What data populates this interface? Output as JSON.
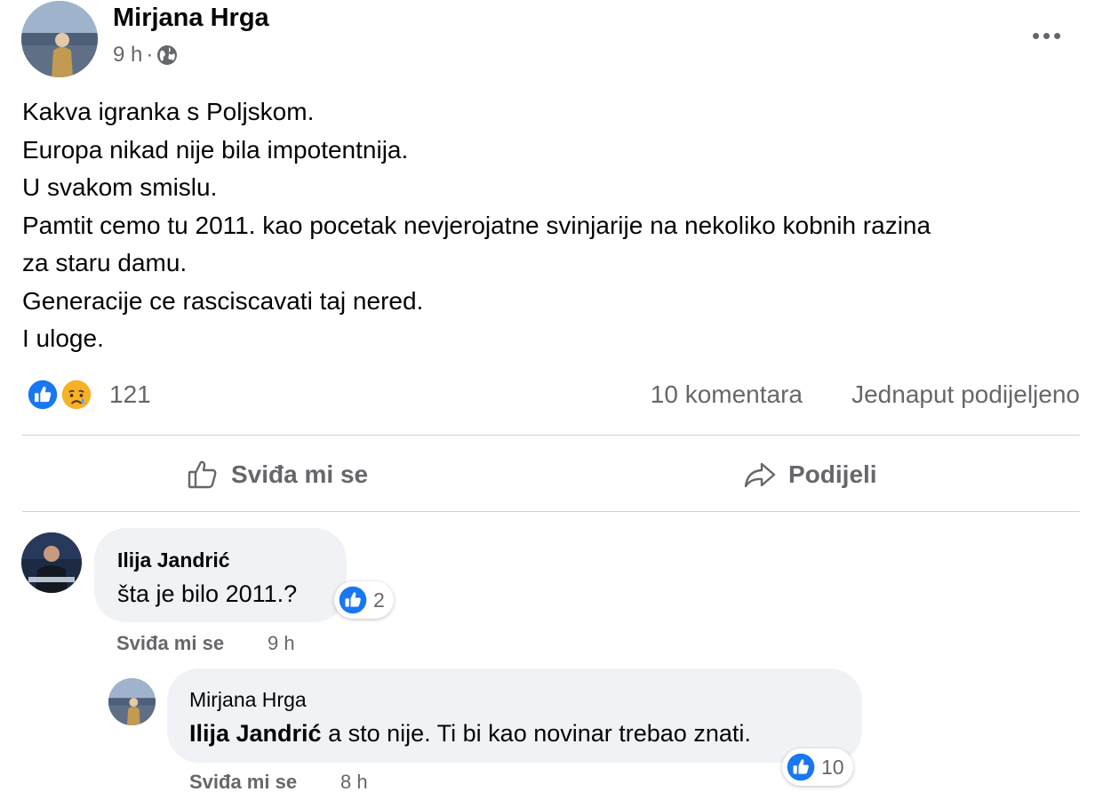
{
  "post": {
    "author": "Mirjana Hrga",
    "time": "9 h",
    "separator": "·",
    "lines": [
      "Kakva igranka s Poljskom.",
      "Europa nikad nije bila impotentnija.",
      "U svakom smislu.",
      "Pamtit cemo tu 2011. kao pocetak nevjerojatne svinjarije na nekoliko kobnih razina",
      "za staru damu.",
      "Generacije ce rasciscavati taj nered.",
      "I uloge."
    ],
    "reaction_icons": [
      "like-icon",
      "sad-icon"
    ],
    "reaction_count": "121",
    "comments_count": "10 komentara",
    "shares": "Jednaput podijeljeno"
  },
  "actions": {
    "like_label": "Sviđa mi se",
    "share_label": "Podijeli"
  },
  "comments": [
    {
      "author": "Ilija Jandrić",
      "text": "šta je bilo 2011.?",
      "reaction_count": "2",
      "like_label": "Sviđa mi se",
      "time": "9 h"
    },
    {
      "author": "Mirjana Hrga",
      "mention": "Ilija Jandrić",
      "text": "a sto nije. Ti bi kao novinar trebao znati.",
      "reaction_count": "10",
      "like_label": "Sviđa mi se",
      "time": "8 h"
    }
  ],
  "colors": {
    "secondary_text": "#65676b",
    "bubble": "#f0f2f5",
    "like_blue": "#1877f2",
    "divider": "#ced0d4"
  }
}
